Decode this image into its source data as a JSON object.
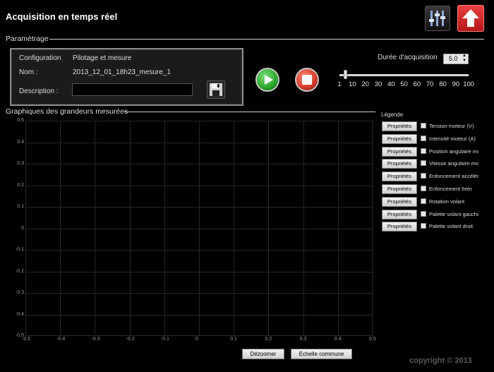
{
  "window": {
    "title": "Acquisition en temps réel"
  },
  "colors": {
    "background": "#000000",
    "play": "#2aa52a",
    "stop": "#d43a2a",
    "upload": "#d62828"
  },
  "toolbar": {
    "icons": [
      "settings-sliders-icon",
      "upload-arrow-icon"
    ]
  },
  "parametrage": {
    "section_label": "Paramétrage",
    "configuration_label": "Configuration",
    "configuration_value": "Pilotage et mesure",
    "nom_label": "Nom :",
    "nom_value": "2013_12_01_18h23_mesure_1",
    "description_label": "Description :",
    "description_value": ""
  },
  "duree": {
    "label": "Durée d'acquisition",
    "value": "5.0",
    "slider_ticks": [
      "1",
      "10",
      "20",
      "30",
      "40",
      "50",
      "60",
      "70",
      "80",
      "90",
      "100"
    ],
    "slider_value": 5
  },
  "graph": {
    "section_label": "Graphiques des grandeurs mesurées",
    "y_ticks": [
      "0.5",
      "0.4",
      "0.3",
      "0.2",
      "0.1",
      "0",
      "-0.1",
      "-0.2",
      "-0.3",
      "-0.4",
      "-0.5"
    ],
    "x_ticks": [
      "-0.5",
      "-0.4",
      "-0.3",
      "-0.2",
      "-0.1",
      "0",
      "0.1",
      "0.2",
      "0.3",
      "0.4",
      "0.5"
    ],
    "dezoomer": "Dézoomer",
    "echelle": "Echelle commune"
  },
  "legende": {
    "title": "Légende",
    "button_label": "Propriétés",
    "items": [
      "Tension moteur (V)",
      "Intensité moteur (A)",
      "Position angulaire mo",
      "Vitesse angulaire mot",
      "Enfoncement accéléra",
      "Enfoncement frein",
      "Rotation volant",
      "Palette volant gauche",
      "Palette volant droit"
    ]
  },
  "footer": {
    "copyright": "copyright © 2013"
  }
}
